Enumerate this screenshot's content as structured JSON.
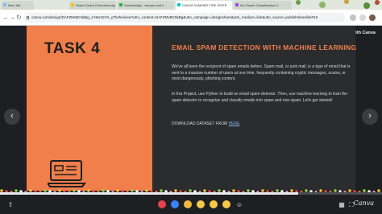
{
  "browser": {
    "tabs": [
      {
        "label": "New Tab",
        "fav": "#8ab4f8",
        "active": false
      },
      {
        "label": "Smart Guard Cubersecurity",
        "fav": "#fbbc04",
        "active": false
      },
      {
        "label": "Smartbridge - devops and h",
        "fav": "#34a853",
        "active": false
      },
      {
        "label": "CANVA SUMMER FIRE INTER",
        "fav": "#00c4cc",
        "active": true
      },
      {
        "label": "Iris Flower Classification Li",
        "fav": "#a142f4",
        "active": false
      }
    ],
    "url": "canva.com/design/DAFZMvBC6kBg_2-t9vm0YK_yTbshe/view?utm_content=DAFZMvBC6kBg&utm_campaign=designshare&utm_medium=link&utm_source=publishsharelink#10"
  },
  "viewer": {
    "create_label": "Create with Canva",
    "progress": 0.78,
    "brand": "Canva"
  },
  "slide": {
    "task_title": "TASK 4",
    "heading": "EMAIL SPAM DETECTION WITH MACHINE LEARNING",
    "paragraph1": "We've all been the recipient of spam emails before. Spam mail, or junk mail, is a type of email that is sent to a massive number of users at one time, frequently containing cryptic messages, scams, or most dangerously, phishing content.",
    "paragraph2": "In this Project, use Python to build an email spam detector. Then, use machine learning to train the spam detector to recognize and classify emails into spam and non-spam. Let's get started!",
    "download_prefix": "DOWNLOAD DATASET FROM ",
    "download_link": "HERE"
  },
  "colors": {
    "accent_orange": "#f07f4b",
    "panel_dark": "#2b2c2e",
    "link": "#7fb6f0"
  }
}
